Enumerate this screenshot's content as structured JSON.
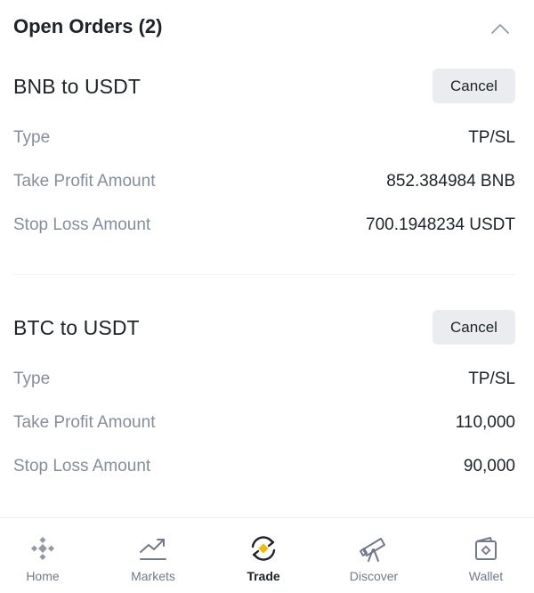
{
  "section": {
    "title": "Open Orders (2)"
  },
  "orders": [
    {
      "title": "BNB to USDT",
      "cancel_label": "Cancel",
      "rows": [
        {
          "label": "Type",
          "value": "TP/SL"
        },
        {
          "label": "Take Profit Amount",
          "value": "852.384984 BNB"
        },
        {
          "label": "Stop Loss Amount",
          "value": "700.1948234 USDT"
        }
      ]
    },
    {
      "title": "BTC to USDT",
      "cancel_label": "Cancel",
      "rows": [
        {
          "label": "Type",
          "value": "TP/SL"
        },
        {
          "label": "Take Profit Amount",
          "value": "110,000"
        },
        {
          "label": "Stop Loss Amount",
          "value": "90,000"
        }
      ]
    }
  ],
  "tabbar": {
    "active": "Trade",
    "tabs": [
      {
        "label": "Home",
        "icon": "binance-logo-icon"
      },
      {
        "label": "Markets",
        "icon": "chart-trend-icon"
      },
      {
        "label": "Trade",
        "icon": "exchange-icon"
      },
      {
        "label": "Discover",
        "icon": "telescope-icon"
      },
      {
        "label": "Wallet",
        "icon": "wallet-icon"
      }
    ]
  },
  "colors": {
    "text_primary": "#1e2329",
    "text_secondary": "#848e9c",
    "button_bg": "#eaecef",
    "accent": "#f0b90b"
  }
}
